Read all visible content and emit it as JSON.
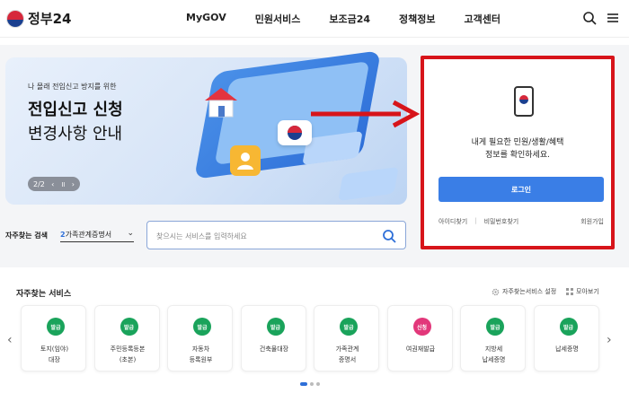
{
  "header": {
    "logo_text": "정부24",
    "nav": [
      "MyGOV",
      "민원서비스",
      "보조금24",
      "정책정보",
      "고객센터"
    ],
    "icons": [
      "search-icon",
      "menu-icon"
    ]
  },
  "banner": {
    "subtitle": "나 몰래 전입신고 방지를 위한",
    "title_line1": "전입신고 신청",
    "title_line2": "변경사항 안내",
    "pager_text": "2/2",
    "pager_prev": "‹",
    "pager_pause": "॥",
    "pager_next": "›"
  },
  "login_card": {
    "message_line1": "내게 필요한 민원/생활/혜택",
    "message_line2": "정보를 확인하세요.",
    "login_button": "로그인",
    "find_id": "아이디찾기",
    "find_password": "비밀번호찾기",
    "signup": "회원가입",
    "highlight_color": "#d7141a"
  },
  "search": {
    "label": "자주찾는 검색",
    "selected_num": "2",
    "selected_text": "가족관계증명서",
    "placeholder": "찾으시는 서비스를 입력하세요"
  },
  "services": {
    "title": "자주찾는 서비스",
    "settings_label": "자주찾는서비스 설정",
    "more_label": "모아보기",
    "items": [
      {
        "badge": "발급",
        "name": "토지(임야)\n대장",
        "color": "#1aa35b"
      },
      {
        "badge": "발급",
        "name": "주민등록등본\n(초본)",
        "color": "#1aa35b"
      },
      {
        "badge": "발급",
        "name": "자동차\n등록원부",
        "color": "#1aa35b"
      },
      {
        "badge": "발급",
        "name": "건축물대장",
        "color": "#1aa35b"
      },
      {
        "badge": "발급",
        "name": "가족관계\n증명서",
        "color": "#1aa35b"
      },
      {
        "badge": "신청",
        "name": "여권재발급",
        "color": "#e2377a"
      },
      {
        "badge": "발급",
        "name": "지방세\n납세증명",
        "color": "#1aa35b"
      },
      {
        "badge": "발급",
        "name": "납세증명",
        "color": "#1aa35b"
      }
    ]
  }
}
